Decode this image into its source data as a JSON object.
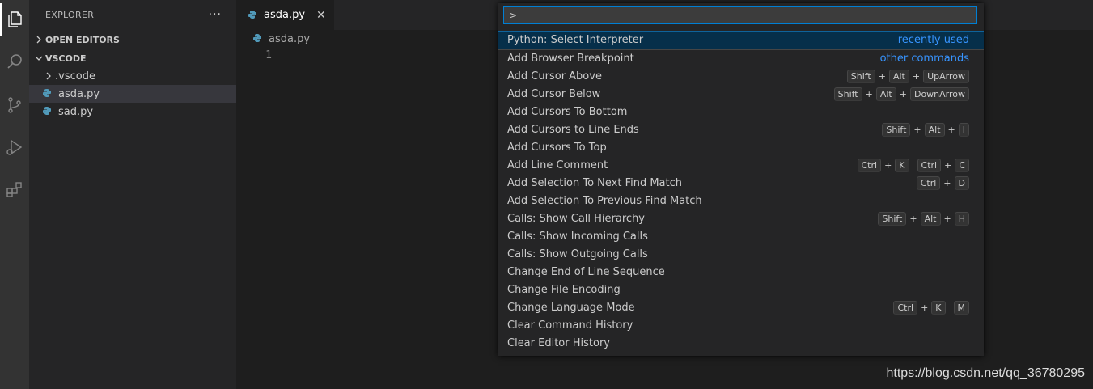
{
  "sidebar": {
    "title": "EXPLORER",
    "more": "···",
    "open_editors": "OPEN EDITORS",
    "workspace": "VSCODE",
    "items": [
      {
        "label": ".vscode",
        "type": "folder"
      },
      {
        "label": "asda.py",
        "type": "python"
      },
      {
        "label": "sad.py",
        "type": "python"
      }
    ]
  },
  "editor": {
    "tab_label": "asda.py",
    "tab_close": "✕",
    "breadcrumb": "asda.py",
    "line_number": "1"
  },
  "palette": {
    "input_value": ">",
    "items": [
      {
        "label": "Python: Select Interpreter",
        "tag": "recently used"
      },
      {
        "label": "Add Browser Breakpoint",
        "tag": "other commands"
      },
      {
        "label": "Add Cursor Above",
        "keys": [
          [
            "Shift",
            "Alt",
            "UpArrow"
          ]
        ]
      },
      {
        "label": "Add Cursor Below",
        "keys": [
          [
            "Shift",
            "Alt",
            "DownArrow"
          ]
        ]
      },
      {
        "label": "Add Cursors To Bottom"
      },
      {
        "label": "Add Cursors to Line Ends",
        "keys": [
          [
            "Shift",
            "Alt",
            "I"
          ]
        ]
      },
      {
        "label": "Add Cursors To Top"
      },
      {
        "label": "Add Line Comment",
        "keys": [
          [
            "Ctrl",
            "K"
          ],
          [
            "Ctrl",
            "C"
          ]
        ]
      },
      {
        "label": "Add Selection To Next Find Match",
        "keys": [
          [
            "Ctrl",
            "D"
          ]
        ]
      },
      {
        "label": "Add Selection To Previous Find Match"
      },
      {
        "label": "Calls: Show Call Hierarchy",
        "keys": [
          [
            "Shift",
            "Alt",
            "H"
          ]
        ]
      },
      {
        "label": "Calls: Show Incoming Calls"
      },
      {
        "label": "Calls: Show Outgoing Calls"
      },
      {
        "label": "Change End of Line Sequence"
      },
      {
        "label": "Change File Encoding"
      },
      {
        "label": "Change Language Mode",
        "keys": [
          [
            "Ctrl",
            "K"
          ],
          [
            "M"
          ]
        ]
      },
      {
        "label": "Clear Command History"
      },
      {
        "label": "Clear Editor History"
      }
    ]
  },
  "watermark": "https://blog.csdn.net/qq_36780295",
  "colors": {
    "accent": "#3794ff",
    "focus_bg": "#062f4a",
    "python_blue": "#519aba"
  }
}
